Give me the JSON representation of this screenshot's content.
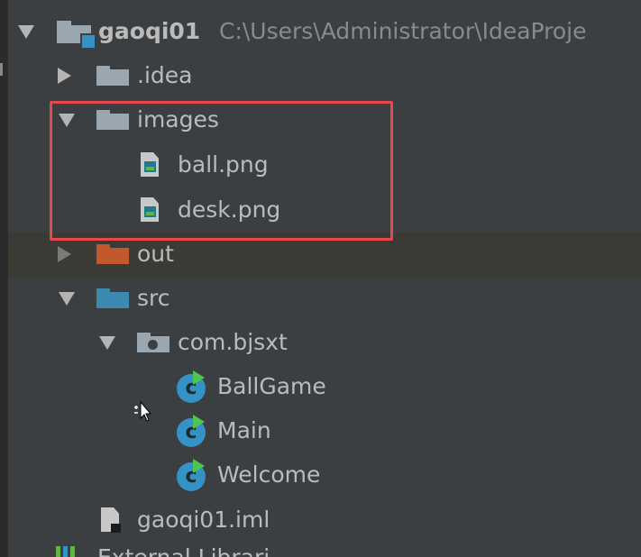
{
  "project_tree": {
    "root": {
      "name": "gaoqi01",
      "path": "C:\\Users\\Administrator\\IdeaProje"
    },
    "items": [
      {
        "name": ".idea"
      },
      {
        "name": "images"
      },
      {
        "name": "ball.png"
      },
      {
        "name": "desk.png"
      },
      {
        "name": "out"
      },
      {
        "name": "src"
      },
      {
        "name": "com.bjsxt"
      },
      {
        "name": "BallGame"
      },
      {
        "name": "Main"
      },
      {
        "name": "Welcome"
      },
      {
        "name": "gaoqi01.iml"
      }
    ],
    "partial_bottom_item": "External Librari"
  },
  "colors": {
    "background": "#3c3f41",
    "text": "#bbbbbb",
    "selection_box": "#e8474e",
    "folder_grey": "#9aa7b0",
    "folder_out": "#c0592c",
    "folder_src": "#3d8ab0",
    "class_icon": "#3592c4",
    "run_marker": "#4ec54e"
  }
}
